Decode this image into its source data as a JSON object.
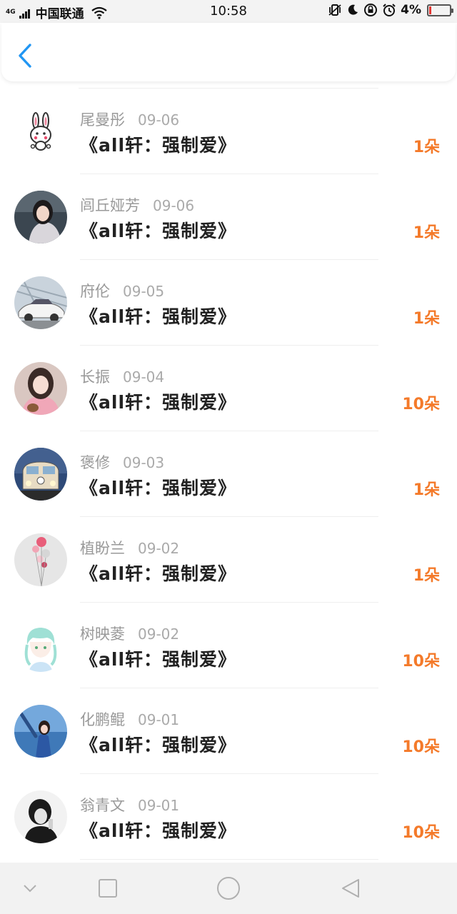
{
  "status_bar": {
    "net_type": "4G",
    "carrier": "中国联通",
    "time": "10:58",
    "battery": "4%",
    "battery_level": 0.04,
    "icons": [
      "signal-icon",
      "wifi-icon",
      "vibrate-icon",
      "moon-icon",
      "rotation-lock-icon",
      "alarm-icon",
      "battery-icon"
    ]
  },
  "header": {
    "back_icon": "chevron-left-icon",
    "accent": "#2196f3"
  },
  "colors": {
    "amount": "#f47a2a",
    "name": "#999999",
    "title": "#222222"
  },
  "list": {
    "items": [
      {
        "name": "尾曼彤",
        "date": "09-06",
        "title": "《all轩：强制爱》",
        "amount": "1朵",
        "avatar": "rabbit"
      },
      {
        "name": "闾丘娅芳",
        "date": "09-06",
        "title": "《all轩：强制爱》",
        "amount": "1朵",
        "avatar": "girl"
      },
      {
        "name": "府伦",
        "date": "09-05",
        "title": "《all轩：强制爱》",
        "amount": "1朵",
        "avatar": "car"
      },
      {
        "name": "长振",
        "date": "09-04",
        "title": "《all轩：强制爱》",
        "amount": "10朵",
        "avatar": "girl-pink"
      },
      {
        "name": "褒修",
        "date": "09-03",
        "title": "《all轩：强制爱》",
        "amount": "1朵",
        "avatar": "van"
      },
      {
        "name": "植盼兰",
        "date": "09-02",
        "title": "《all轩：强制爱》",
        "amount": "1朵",
        "avatar": "balloons"
      },
      {
        "name": "树映菱",
        "date": "09-02",
        "title": "《all轩：强制爱》",
        "amount": "10朵",
        "avatar": "anime"
      },
      {
        "name": "化鹏鲲",
        "date": "09-01",
        "title": "《all轩：强制爱》",
        "amount": "10朵",
        "avatar": "sea"
      },
      {
        "name": "翁青文",
        "date": "09-01",
        "title": "《all轩：强制爱》",
        "amount": "10朵",
        "avatar": "bw"
      }
    ]
  },
  "nav_bar": {
    "icons": [
      "collapse-icon",
      "recent-apps-icon",
      "home-icon",
      "back-icon"
    ]
  }
}
